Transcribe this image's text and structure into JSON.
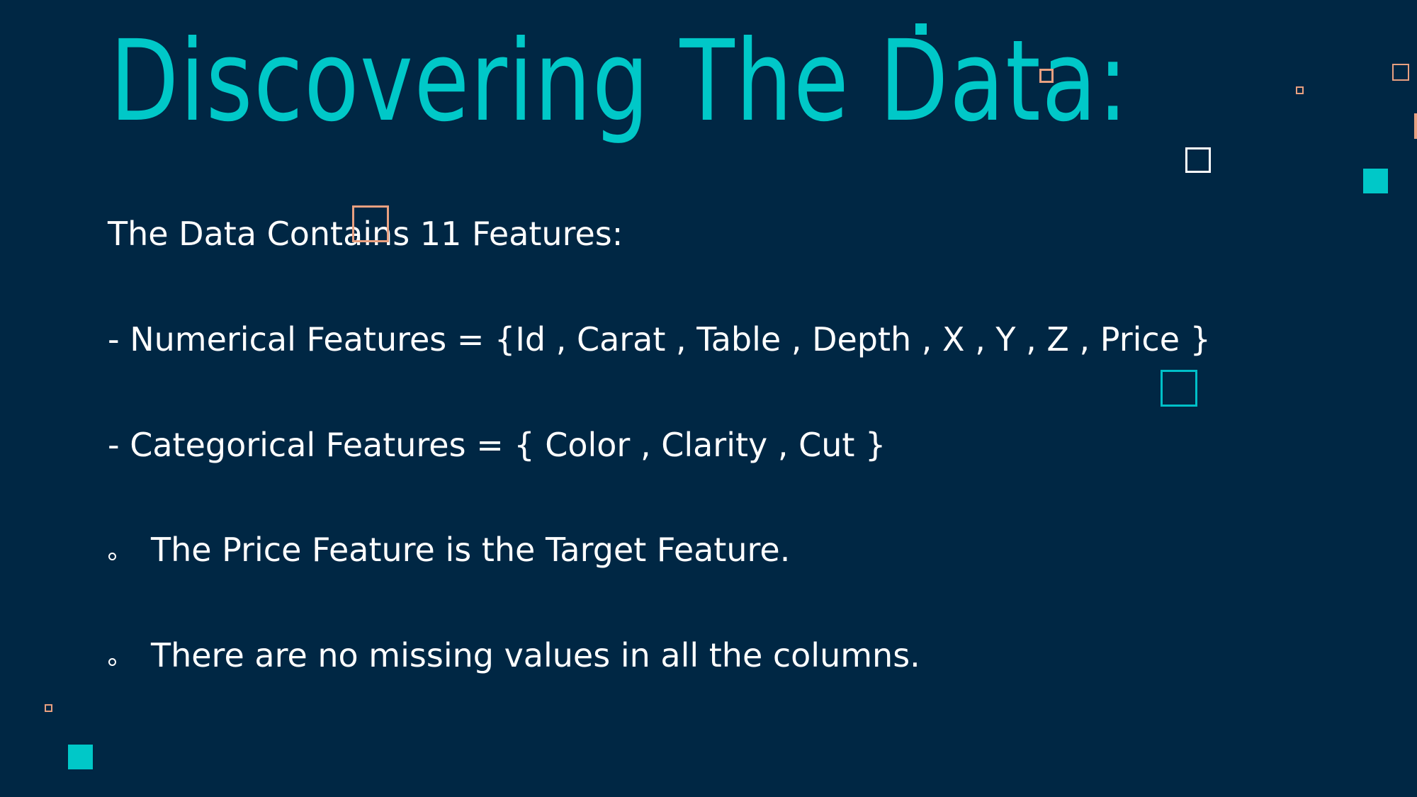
{
  "slide": {
    "title": "Discovering The Data:",
    "intro": "The Data Contains 11 Features:",
    "numerical_features": "- Numerical Features = {Id , Carat , Table , Depth , X , Y , Z , Price }",
    "categorical_features": "- Categorical Features = { Color , Clarity , Cut }",
    "bullets": [
      "The Price Feature is the Target Feature.",
      "There are no missing values in all the columns."
    ]
  },
  "colors": {
    "background": "#002744",
    "title": "#00c8c8",
    "body_text": "#ffffff",
    "accent_teal": "#00c8c8",
    "accent_orange": "#e8a080"
  }
}
